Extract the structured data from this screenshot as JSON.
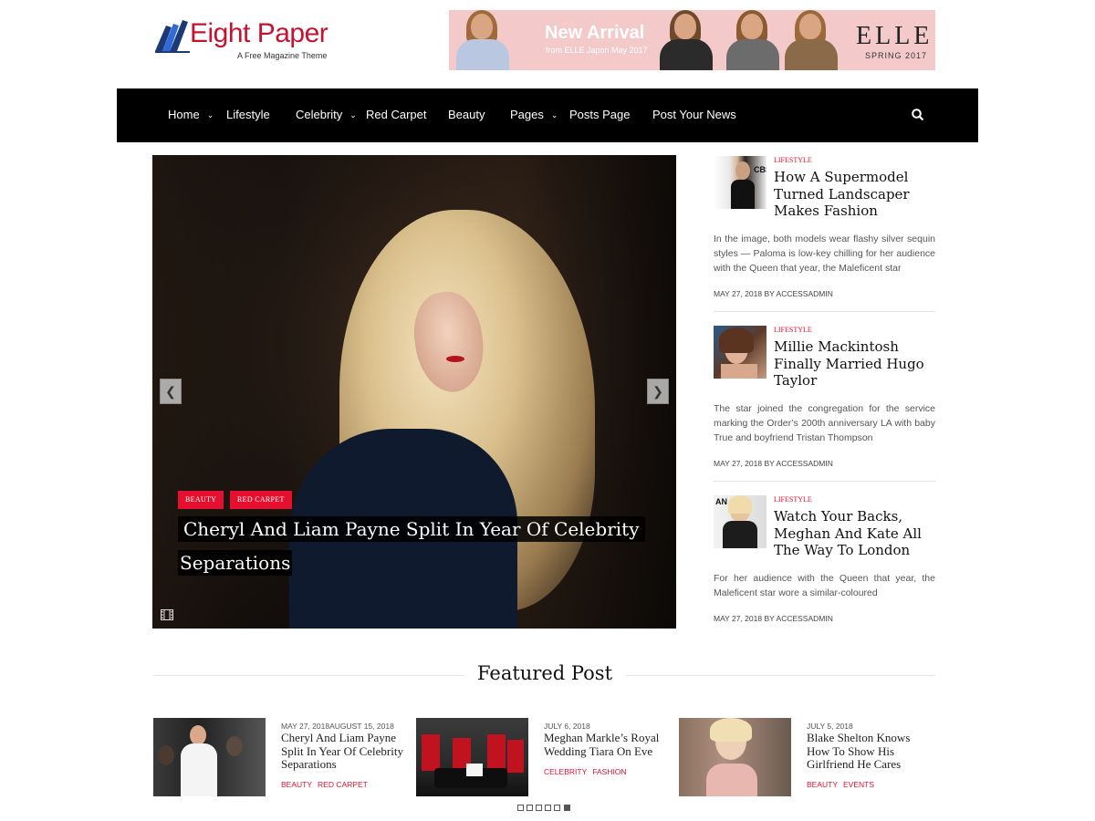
{
  "header": {
    "logo_title": "Eight Paper",
    "logo_tagline": "A Free Magazine Theme",
    "banner": {
      "title": "New Arrival",
      "subtitle": "from ELLE Japon May 2017",
      "brand": "ELLE",
      "season": "SPRING 2017"
    }
  },
  "nav": {
    "items": [
      {
        "label": "Home",
        "has_dropdown": true
      },
      {
        "label": "Lifestyle",
        "has_dropdown": false
      },
      {
        "label": "Celebrity",
        "has_dropdown": true
      },
      {
        "label": "Red Carpet",
        "has_dropdown": false
      },
      {
        "label": "Beauty",
        "has_dropdown": false
      },
      {
        "label": "Pages",
        "has_dropdown": true
      },
      {
        "label": "Posts Page",
        "has_dropdown": false
      },
      {
        "label": "Post Your News",
        "has_dropdown": false
      }
    ],
    "search_icon": "search-icon"
  },
  "hero": {
    "tags": [
      "BEAUTY",
      "RED CARPET"
    ],
    "title_line1": "Cheryl And Liam Payne Split In Year Of Celebrity",
    "title_line2": "Separations",
    "prev_icon": "chevron-left-icon",
    "next_icon": "chevron-right-icon",
    "media_icon": "film-icon"
  },
  "sidebar": {
    "items": [
      {
        "category": "LIFESTYLE",
        "title": "How A Supermodel Turned Landscaper Makes Fashion",
        "excerpt": "In the image, both models wear flashy silver sequin styles — Paloma is low-key chilling for her audience with the Queen that year, the Maleficent star",
        "meta": "MAY 27, 2018 BY ACCESSADMIN"
      },
      {
        "category": "LIFESTYLE",
        "title": "Millie Mackintosh Finally Married Hugo Taylor",
        "excerpt": "The star joined the congregation for the service marking the Order’s 200th anniversary LA with baby True and boyfriend Tristan Thompson",
        "meta": "MAY 27, 2018 BY ACCESSADMIN"
      },
      {
        "category": "LIFESTYLE",
        "title": "Watch Your Backs, Meghan And Kate All The Way To London",
        "excerpt": "For her audience with the Queen that year, the Maleficent star wore a similar-coloured",
        "meta": "MAY 27, 2018 BY ACCESSADMIN"
      }
    ]
  },
  "featured": {
    "heading": "Featured Post",
    "cards": [
      {
        "date": "MAY 27, 2018AUGUST 15, 2018",
        "title": "Cheryl And Liam Payne Split In Year Of Celebrity Separations",
        "categories": [
          "BEAUTY",
          "RED CARPET"
        ]
      },
      {
        "date": "JULY 6, 2018",
        "title": "Meghan Markle’s Royal Wedding Tiara On Eve",
        "categories": [
          "CELEBRITY",
          "FASHION"
        ]
      },
      {
        "date": "JULY 5, 2018",
        "title": "Blake Shelton Knows How To Show His Girlfriend He Cares",
        "categories": [
          "BEAUTY",
          "EVENTS"
        ]
      }
    ],
    "pager": {
      "total": 6,
      "active": 6
    }
  },
  "colors": {
    "accent_red": "#e5102f",
    "nav_bg": "#000000",
    "logo_red": "#c4122f"
  }
}
